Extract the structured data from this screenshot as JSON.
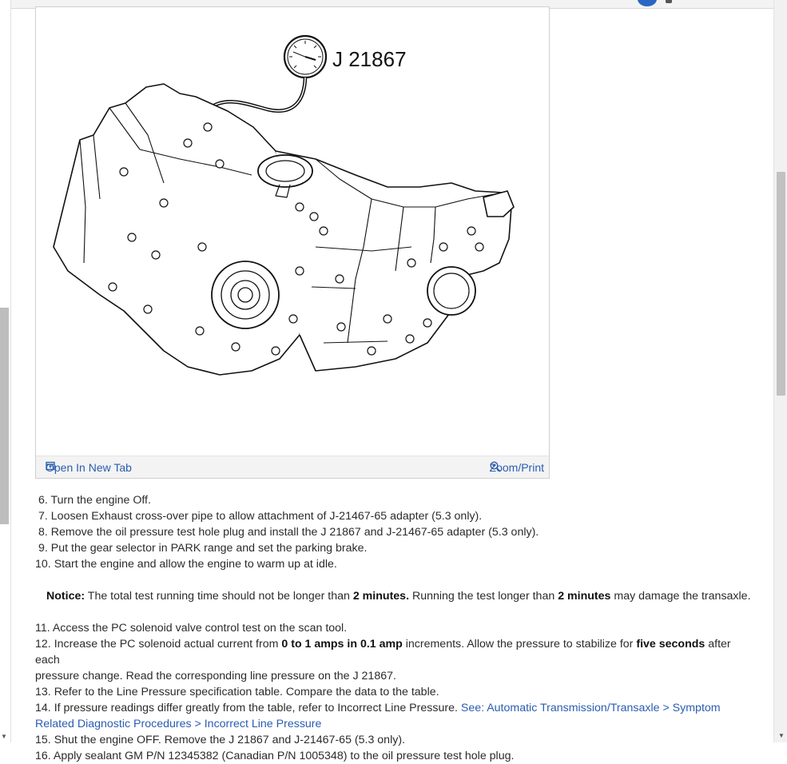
{
  "figure": {
    "gauge_label": "J 21867",
    "open_new_tab": "Open In New Tab",
    "zoom_print": "Zoom/Print"
  },
  "steps_a": [
    {
      "num": "6.",
      "text": "Turn the engine Off."
    },
    {
      "num": "7.",
      "text": "Loosen Exhaust cross-over pipe to allow attachment of J-21467-65 adapter (5.3 only)."
    },
    {
      "num": "8.",
      "text": "Remove the oil pressure test hole plug and install the J 21867 and J-21467-65 adapter (5.3 only)."
    },
    {
      "num": "9.",
      "text": "Put the gear selector in PARK range and set the parking brake."
    },
    {
      "num": "10.",
      "text": "Start the engine and allow the engine to warm up at idle."
    }
  ],
  "notice": {
    "label": "Notice:",
    "t1": "The total test running time should not be longer than",
    "b1": "2 minutes.",
    "t2": "Running the test longer than",
    "b2": "2 minutes",
    "t3": "may damage the transaxle."
  },
  "step11": {
    "num": "11.",
    "text": "Access the PC solenoid valve control test on the scan tool."
  },
  "step12": {
    "num": "12.",
    "t1": "Increase the PC solenoid actual current from",
    "b1": "0 to 1 amps in 0.1 amp",
    "t2": "increments. Allow the pressure to stabilize for",
    "b2": "five seconds",
    "t3": "after each",
    "line2": "pressure change. Read the corresponding line pressure on the J 21867."
  },
  "step13": {
    "num": "13.",
    "text": "Refer to the Line Pressure specification table. Compare the data to the table."
  },
  "step14": {
    "num": "14.",
    "text": "If pressure readings differ greatly from the table, refer to Incorrect Line Pressure.",
    "link_part1": "See: Automatic Transmission/Transaxle > Symptom",
    "link_part2": "Related Diagnostic Procedures > Incorrect Line Pressure"
  },
  "step15": {
    "num": "15.",
    "text": "Shut the engine OFF. Remove the J 21867 and J-21467-65 (5.3 only)."
  },
  "step16": {
    "num": "16.",
    "text": "Apply sealant GM P/N 12345382 (Canadian P/N 1005348) to the oil pressure test hole plug."
  },
  "icons": {
    "open_tab": "open-in-new-tab-icon",
    "zoom": "magnifier-zoom-icon"
  },
  "colors": {
    "link": "#2a5db0",
    "footer_bg": "#f3f3f3"
  }
}
